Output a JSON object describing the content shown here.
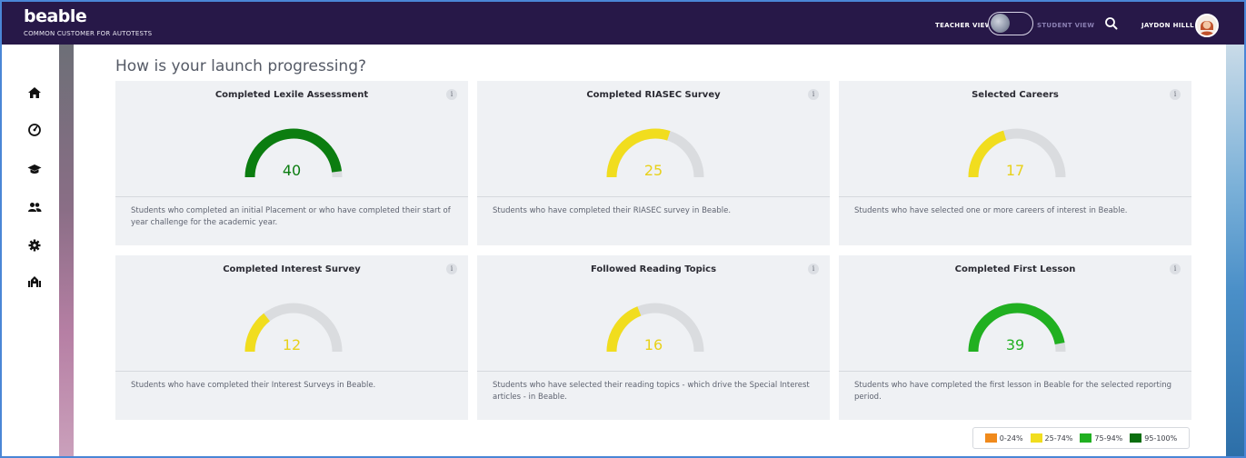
{
  "app": {
    "logo": "beable",
    "subtitle": "COMMON CUSTOMER FOR AUTOTESTS"
  },
  "topbar": {
    "teacher_view_label": "TEACHER VIEW",
    "student_view_label": "STUDENT VIEW",
    "view_mode": "teacher",
    "user_name": "JAYDON HILLL"
  },
  "sidebar": {
    "items": [
      {
        "icon": "home-icon"
      },
      {
        "icon": "dashboard-icon"
      },
      {
        "icon": "graduation-cap-icon"
      },
      {
        "icon": "users-icon"
      },
      {
        "icon": "gear-icon"
      },
      {
        "icon": "school-icon"
      }
    ]
  },
  "main": {
    "title": "How is your launch progressing?",
    "cards": [
      {
        "title": "Completed Lexile Assessment",
        "value": "40",
        "percent": 96,
        "color": "#0b7d10",
        "description": "Students who completed an initial Placement or who have completed their start of year challenge for the academic year."
      },
      {
        "title": "Completed RIASEC Survey",
        "value": "25",
        "percent": 60,
        "color": "#f1dd1e",
        "description": "Students who have completed their RIASEC survey in Beable."
      },
      {
        "title": "Selected Careers",
        "value": "17",
        "percent": 41,
        "color": "#f1dd1e",
        "description": "Students who have selected one or more careers of interest in Beable."
      },
      {
        "title": "Completed Interest Survey",
        "value": "12",
        "percent": 29,
        "color": "#f1dd1e",
        "description": "Students who have completed their Interest Surveys in Beable."
      },
      {
        "title": "Followed Reading Topics",
        "value": "16",
        "percent": 38,
        "color": "#f1dd1e",
        "description": "Students who have selected their reading topics - which drive the Special Interest articles - in Beable."
      },
      {
        "title": "Completed First Lesson",
        "value": "39",
        "percent": 94,
        "color": "#21b021",
        "description": "Students who have completed the first lesson in Beable for the selected reporting period."
      }
    ]
  },
  "legend": [
    {
      "label": "0-24%",
      "color": "#f08a1c"
    },
    {
      "label": "25-74%",
      "color": "#f1dd1e"
    },
    {
      "label": "75-94%",
      "color": "#21b021"
    },
    {
      "label": "95-100%",
      "color": "#0b6e0f"
    }
  ],
  "colors": {
    "topbar": "#271848",
    "gauge_track": "#dadcdf"
  }
}
